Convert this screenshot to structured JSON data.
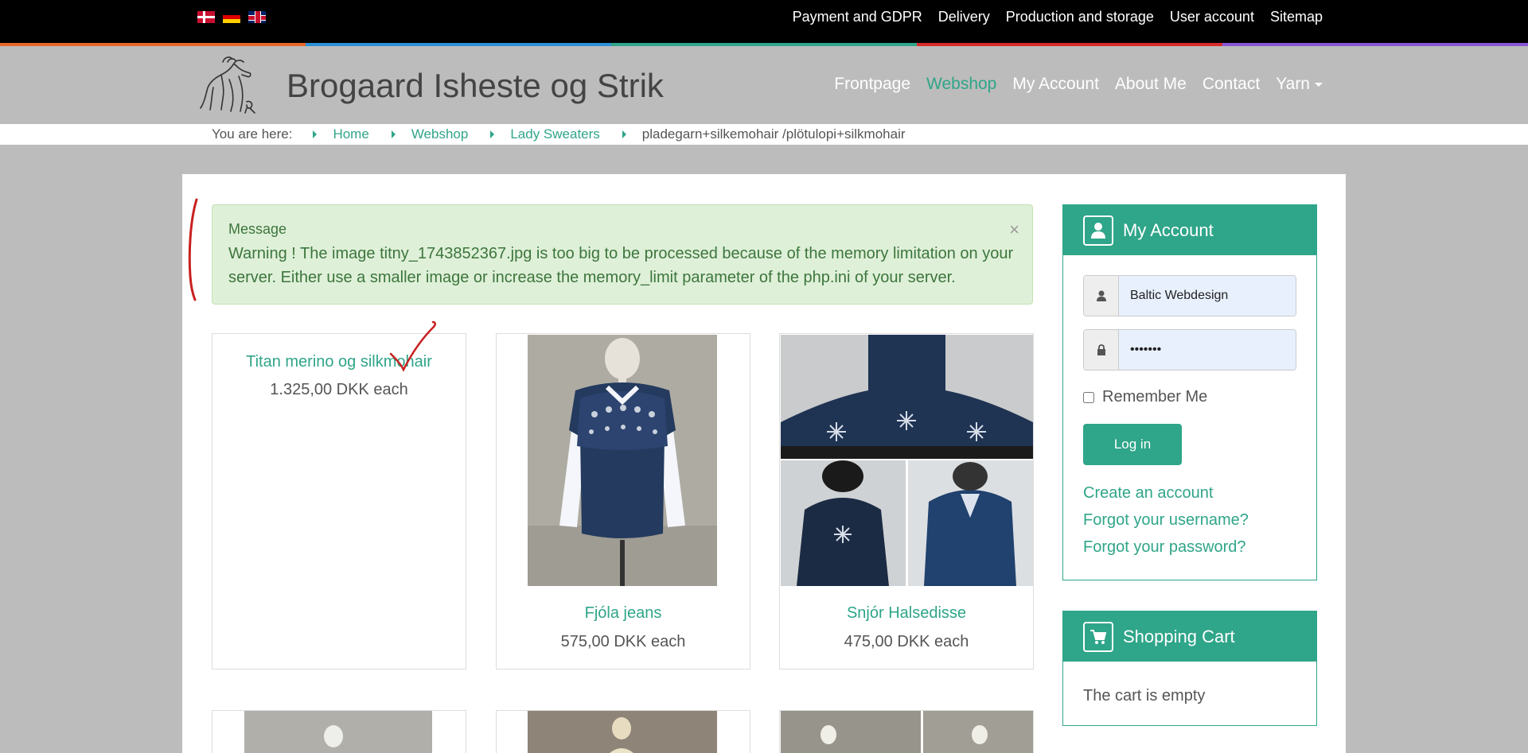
{
  "topbar": {
    "flags": [
      "dk-flag-icon",
      "de-flag-icon",
      "uk-flag-icon"
    ],
    "links": [
      "Payment and GDPR",
      "Delivery",
      "Production and storage",
      "User account",
      "Sitemap"
    ]
  },
  "colors": {
    "accent": "#2fa589",
    "rainbow": [
      "#e8662a",
      "#2d8fd5",
      "#2fa589",
      "#d92b2b",
      "#8a56d6"
    ]
  },
  "header": {
    "title": "Brogaard Isheste og Strik",
    "logo": "horse-logo-icon",
    "nav": [
      "Frontpage",
      "Webshop",
      "My Account",
      "About Me",
      "Contact",
      "Yarn"
    ],
    "active_nav": "Webshop"
  },
  "breadcrumb": {
    "label": "You are here:",
    "items": [
      "Home",
      "Webshop",
      "Lady Sweaters"
    ],
    "current": "pladegarn+silkemohair /plötulopi+silkmohair"
  },
  "alert": {
    "title": "Message",
    "text": "Warning ! The image titny_1743852367.jpg is too big to be processed because of the memory limitation on your server. Either use a smaller image or increase the memory_limit parameter of the php.ini of your server.",
    "close": "×"
  },
  "products": [
    {
      "name": "Titan merino og silkmohair",
      "price": "1.325,00 DKK each"
    },
    {
      "name": "Fjóla jeans",
      "price": "575,00 DKK each"
    },
    {
      "name": "Snjór Halsedisse",
      "price": "475,00 DKK each"
    }
  ],
  "login": {
    "title": "My Account",
    "username": "Baltic Webdesign",
    "password": "•••••••",
    "remember": "Remember Me",
    "button": "Log in",
    "links": [
      "Create an account",
      "Forgot your username?",
      "Forgot your password?"
    ]
  },
  "cart": {
    "title": "Shopping Cart",
    "text": "The cart is empty"
  }
}
